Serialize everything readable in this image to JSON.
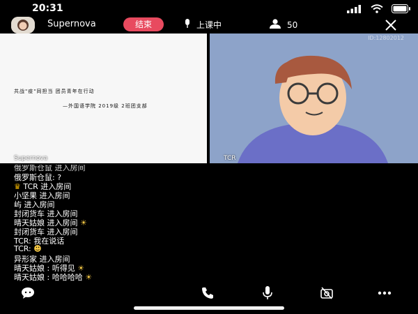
{
  "status": {
    "time": "20:31"
  },
  "header": {
    "user_name": "Supernova",
    "end_label": "结束",
    "class_status": "上课中",
    "count": "50"
  },
  "video": {
    "left": {
      "line1": "共战\"疫\"同担当    团员青年在行动",
      "line2": "—外国语学院 2019级 2班团支部",
      "label": "Supernova"
    },
    "right": {
      "label": "TCR",
      "id": "ID:12802012"
    }
  },
  "chat": [
    {
      "text": "俄罗斯仓鼠 进入房间"
    },
    {
      "text": "俄罗斯仓鼠: ?"
    },
    {
      "text": "TCR 进入房间"
    },
    {
      "text": "小坚果 进入房间"
    },
    {
      "text": "屿 进入房间"
    },
    {
      "text": "封闭货车 进入房间"
    },
    {
      "text": "晴天姑娘 进入房间"
    },
    {
      "text": "封闭货车 进入房间"
    },
    {
      "text": "TCR: 我在说话"
    },
    {
      "text": "TCR:"
    },
    {
      "text": "异形家 进入房间"
    },
    {
      "text": "晴天姑娘 : 听得见"
    },
    {
      "text": "晴天姑娘 : 哈哈哈哈"
    }
  ]
}
